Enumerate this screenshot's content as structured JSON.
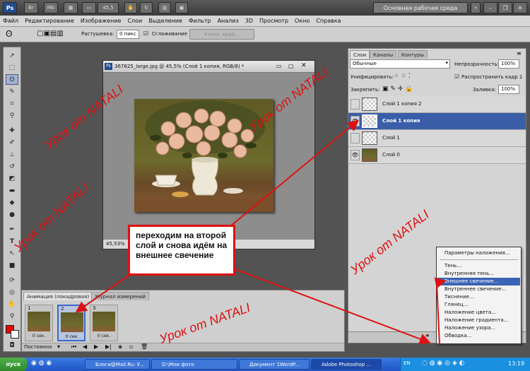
{
  "titlebar": {
    "app_logo": "Ps",
    "buttons": [
      "Br",
      "Mb"
    ],
    "zoom": "45,5",
    "workspace": "Основная рабочая среда",
    "window_controls": [
      "–",
      "❐",
      "✕"
    ]
  },
  "menubar": {
    "items": [
      "Файл",
      "Редактирование",
      "Изображение",
      "Слои",
      "Выделение",
      "Фильтр",
      "Анализ",
      "3D",
      "Просмотр",
      "Окно",
      "Справка"
    ]
  },
  "options": {
    "feather_label": "Растушевка:",
    "feather_value": "0 пикс",
    "antialias_label": "Сглаживание",
    "antialias_checked": true,
    "refine_button": "Уточн. край..."
  },
  "document": {
    "icon": "Ps",
    "title": "367825_large.jpg @ 45,5% (Слой 1 копия, RGB/8) *",
    "status_zoom": "45,53%"
  },
  "layers_panel": {
    "tabs": [
      "Слои",
      "Каналы",
      "Контуры"
    ],
    "blend_mode": "Обычные",
    "opacity_label": "Непрозрачность:",
    "opacity_value": "100%",
    "unify_label": "Унифицировать:",
    "propagate_label": "Распространить кадр 1",
    "lock_label": "Закрепить:",
    "fill_label": "Заливка:",
    "fill_value": "100%",
    "layers": [
      {
        "name": "Слой 1 копия 2",
        "visible": false,
        "selected": false,
        "photo": false
      },
      {
        "name": "Слой 1 копия",
        "visible": true,
        "selected": true,
        "photo": false
      },
      {
        "name": "Слой 1",
        "visible": false,
        "selected": false,
        "photo": false
      },
      {
        "name": "Слой 0",
        "visible": true,
        "selected": false,
        "photo": true
      }
    ]
  },
  "context_menu": {
    "items": [
      {
        "label": "Параметры наложения...",
        "highlight": false
      },
      {
        "label": "Тень...",
        "highlight": false
      },
      {
        "label": "Внутренняя тень...",
        "highlight": false
      },
      {
        "label": "Внешнее свечение...",
        "highlight": true
      },
      {
        "label": "Внутреннее свечение...",
        "highlight": false
      },
      {
        "label": "Тиснение...",
        "highlight": false
      },
      {
        "label": "Глянец...",
        "highlight": false
      },
      {
        "label": "Наложение цвета...",
        "highlight": false
      },
      {
        "label": "Наложение градиента...",
        "highlight": false
      },
      {
        "label": "Наложение узора...",
        "highlight": false
      },
      {
        "label": "Обводка...",
        "highlight": false
      }
    ]
  },
  "animation_panel": {
    "tabs": [
      "Анимация (покадровая)",
      "Журнал измерений"
    ],
    "frames": [
      {
        "number": "1",
        "delay": "0 сек.",
        "selected": false
      },
      {
        "number": "2",
        "delay": "0 сек.",
        "selected": true
      },
      {
        "number": "3",
        "delay": "0 сек.",
        "selected": false
      }
    ],
    "loop": "Постоянно"
  },
  "callout": "переходим на второй слой и снова идём на внешнее свечение",
  "watermark": "Урок от NATALI",
  "taskbar": {
    "start": "пуск",
    "tasks": [
      {
        "label": "Блоги@Mail.Ru: У...",
        "active": false
      },
      {
        "label": "D:\\Мои фото",
        "active": false
      },
      {
        "label": "Документ 1WordP...",
        "active": false
      },
      {
        "label": "Adobe Photoshop ...",
        "active": true
      }
    ],
    "lang": "EN",
    "clock": "13:19"
  },
  "colors": {
    "accent": "#3a5ea8",
    "annotation_red": "#dd1111"
  }
}
